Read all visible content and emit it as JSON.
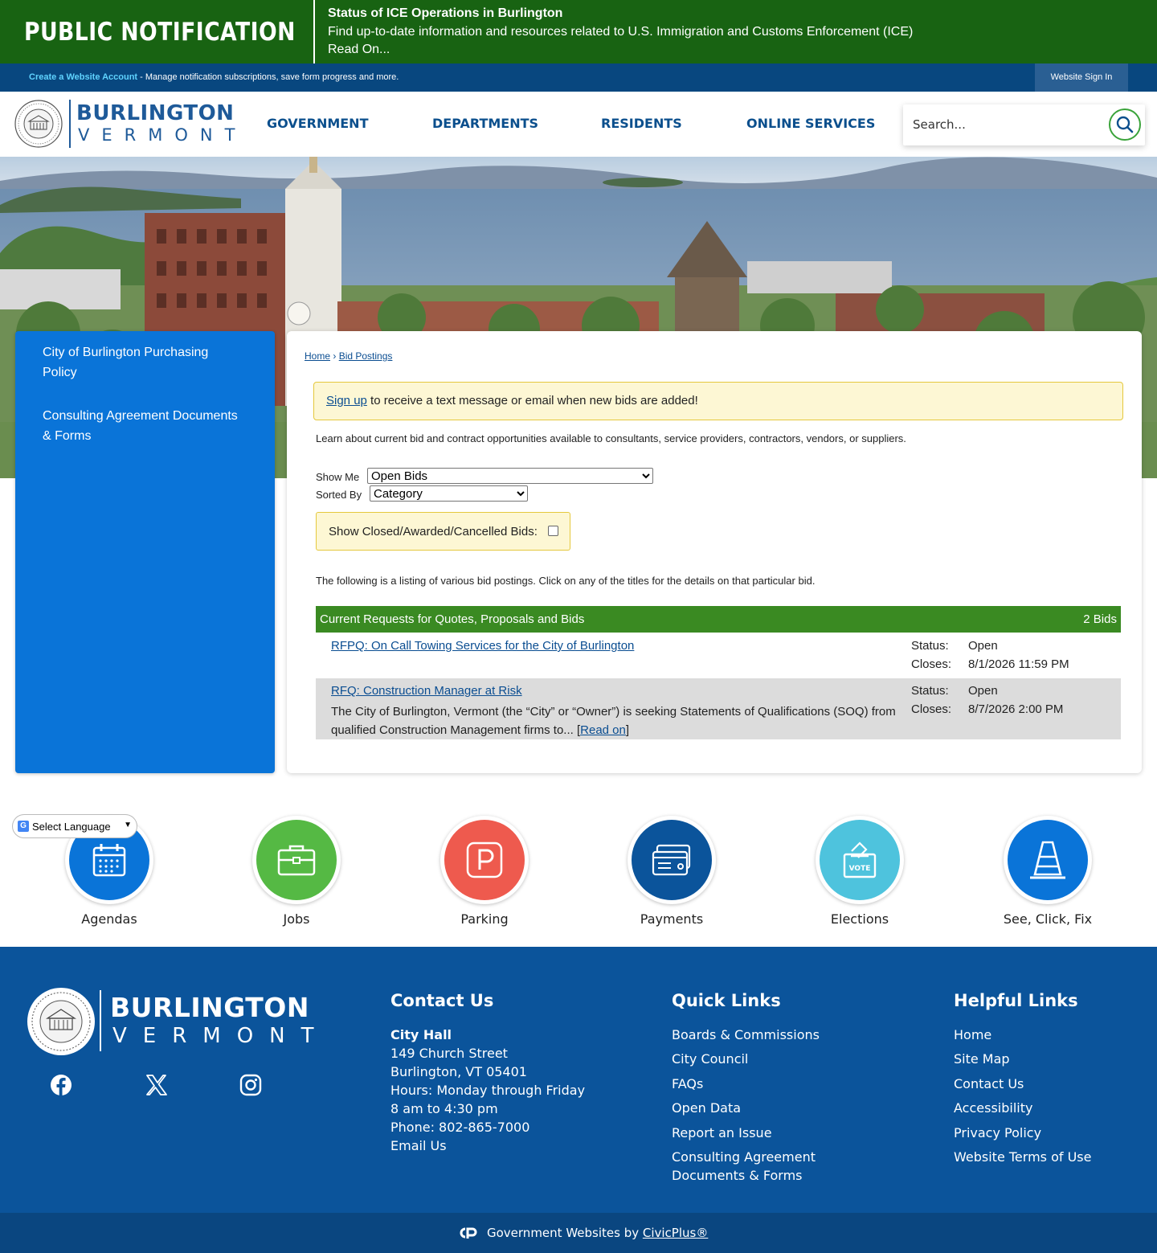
{
  "alert": {
    "brand": "PUBLIC NOTIFICATION",
    "title": "Status of ICE Operations in Burlington",
    "body": "Find up-to-date information and resources related to U.S. Immigration and Customs Enforcement (ICE)",
    "read_on": "Read On..."
  },
  "account": {
    "create_label": "Create a Website Account",
    "create_desc": " - Manage notification subscriptions, save form progress and more.",
    "signin_label": "Website Sign In"
  },
  "header": {
    "logo_line1": "BURLINGTON",
    "logo_line2": "VERMONT",
    "nav": [
      "GOVERNMENT",
      "DEPARTMENTS",
      "RESIDENTS",
      "ONLINE SERVICES"
    ],
    "search_placeholder": "Search..."
  },
  "sidenav": {
    "items": [
      "City of Burlington Purchasing Policy",
      "Consulting Agreement Documents & Forms"
    ]
  },
  "content": {
    "breadcrumb": [
      "Home",
      "Bid Postings"
    ],
    "breadcrumb_sep": "›",
    "signup_link": "Sign up",
    "signup_text": " to receive a text message or email when new bids are added!",
    "intro": "Learn about current bid and contract opportunities available to consultants, service providers, contractors, vendors, or suppliers.",
    "show_me_label": "Show Me",
    "show_me_value": "Open Bids",
    "sorted_by_label": "Sorted By",
    "sorted_by_value": "Category",
    "closed_label": "Show Closed/Awarded/Cancelled Bids:",
    "listing_note": "The following is a listing of various bid postings. Click on any of the titles for the details on that particular bid.",
    "table_title": "Current Requests for Quotes, Proposals and Bids",
    "table_count": "2 Bids",
    "bids": [
      {
        "title": "RFPQ: On Call Towing Services for the City of Burlington",
        "desc": "",
        "read_on": "",
        "status_label": "Status:",
        "status": "Open",
        "closes_label": "Closes:",
        "closes": "8/1/2026 11:59 PM"
      },
      {
        "title": "RFQ: Construction Manager at Risk",
        "desc": "The City of Burlington, Vermont (the “City” or “Owner”) is seeking Statements of Qualifications (SOQ) from qualified Construction Management firms to... ",
        "read_on": "Read on",
        "status_label": "Status:",
        "status": "Open",
        "closes_label": "Closes:",
        "closes": "8/7/2026 2:00 PM"
      }
    ]
  },
  "translate": {
    "label": "Select Language"
  },
  "quick_links": [
    {
      "label": "Agendas",
      "icon": "calendar-icon",
      "color": "#0a74d8"
    },
    {
      "label": "Jobs",
      "icon": "briefcase-icon",
      "color": "#55b944"
    },
    {
      "label": "Parking",
      "icon": "parking-icon",
      "color": "#ee5a4e"
    },
    {
      "label": "Payments",
      "icon": "payment-card-icon",
      "color": "#0b549b"
    },
    {
      "label": "Elections",
      "icon": "ballot-box-icon",
      "color": "#4ec3dd"
    },
    {
      "label": "See, Click, Fix",
      "icon": "traffic-cone-icon",
      "color": "#0a74d8"
    }
  ],
  "footer": {
    "logo_line1": "BURLINGTON",
    "logo_line2": "VERMONT",
    "contact_heading": "Contact Us",
    "contact": {
      "name": "City Hall",
      "street": "149 Church Street",
      "city": "Burlington, VT 05401",
      "hours1": "Hours: Monday through Friday",
      "hours2": "8 am to 4:30 pm",
      "phone": "Phone: 802-865-7000",
      "email": "Email Us"
    },
    "quick_heading": "Quick Links",
    "quick": [
      "Boards & Commissions",
      "City Council",
      "FAQs",
      "Open Data",
      "Report an Issue",
      "Consulting Agreement",
      "Documents & Forms"
    ],
    "helpful_heading": "Helpful Links",
    "helpful": [
      "Home",
      "Site Map",
      "Contact Us",
      "Accessibility",
      "Privacy Policy",
      "Website Terms of Use"
    ],
    "powered_text": "Government Websites by ",
    "powered_link": "CivicPlus®"
  },
  "colors": {
    "alert_green": "#186312",
    "account_blue": "#08477f",
    "nav_blue": "#0b4f8d",
    "side_blue": "#0a74d8",
    "table_green": "#3a8a22",
    "footer_blue": "#0b549b"
  }
}
